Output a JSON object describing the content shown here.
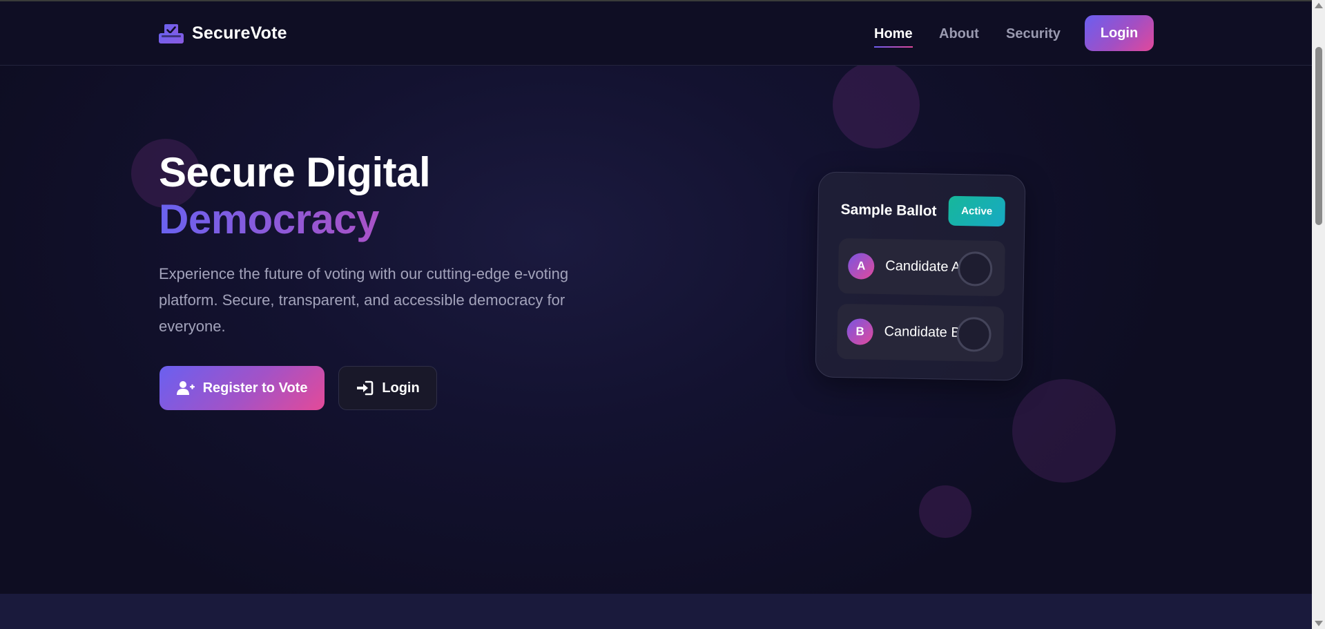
{
  "brand": {
    "name": "SecureVote",
    "icon": "ballot-box-check-icon"
  },
  "nav": {
    "home": "Home",
    "about": "About",
    "security": "Security",
    "login": "Login"
  },
  "hero": {
    "title_line1": "Secure Digital",
    "title_line2": "Democracy",
    "description": "Experience the future of voting with our cutting-edge e-voting platform. Secure, transparent, and accessible democracy for everyone.",
    "register_label": "Register to Vote",
    "register_icon": "user-plus-icon",
    "login_label": "Login",
    "login_icon": "sign-in-icon"
  },
  "ballot": {
    "title": "Sample Ballot",
    "status": "Active",
    "candidates": [
      {
        "initial": "A",
        "name": "Candidate A"
      },
      {
        "initial": "B",
        "name": "Candidate B"
      }
    ]
  },
  "colors": {
    "accent_start": "#6a60f0",
    "accent_end": "#e44a98",
    "badge": "#17b79a",
    "background": "#0e0d22"
  }
}
